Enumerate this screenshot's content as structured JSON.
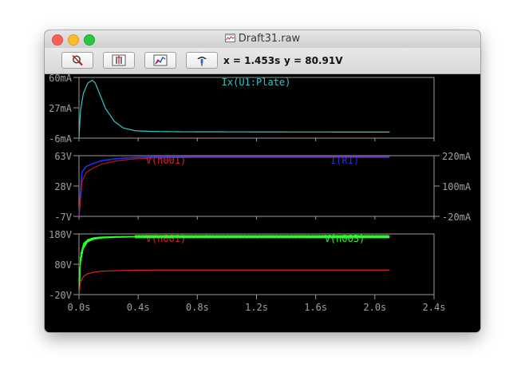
{
  "window": {
    "title": "Draft31.raw"
  },
  "toolbar": {
    "buttons": [
      {
        "icon": "zoom-cancel-icon"
      },
      {
        "icon": "autorange-y-icon"
      },
      {
        "icon": "zoom-extents-icon"
      },
      {
        "icon": "probe-icon"
      }
    ],
    "x_readout": "x = 1.453s",
    "y_readout": "y = 80.91V"
  },
  "colors": {
    "background": "#000000",
    "frame": "#9a9a9a",
    "tick_text": "#a0a0a0",
    "cyan": "#32c8c8",
    "red": "#e42222",
    "blue": "#2c2cf0",
    "purple": "#b02ad8",
    "green": "#28ff28"
  },
  "x_axis": {
    "ticks": [
      "0.0s",
      "0.4s",
      "0.8s",
      "1.2s",
      "1.6s",
      "2.0s",
      "2.4s"
    ],
    "range": [
      0,
      2.4
    ]
  },
  "chart_data": [
    {
      "type": "line",
      "series": [
        {
          "name": "Ix(U1:Plate)",
          "color": "#32c8c8",
          "x": [
            0,
            0.01,
            0.03,
            0.06,
            0.09,
            0.11,
            0.14,
            0.18,
            0.24,
            0.3,
            0.38,
            0.5,
            0.7,
            1.0,
            1.4,
            2.1
          ],
          "y": [
            -6,
            24,
            43,
            54,
            57,
            54,
            42,
            26,
            12,
            5,
            2,
            1.2,
            0.9,
            0.8,
            0.7,
            0.6
          ]
        }
      ],
      "left_axis": {
        "ticks": [
          "60mA",
          "27mA",
          "-6mA"
        ],
        "range": [
          -6,
          60
        ]
      }
    },
    {
      "type": "line",
      "series": [
        {
          "name": "V(n001)",
          "color": "#e42222",
          "x": [
            0,
            0.02,
            0.05,
            0.1,
            0.15,
            0.25,
            0.35,
            0.5,
            0.8,
            1.2,
            1.6,
            2.1
          ],
          "y": [
            -7,
            33,
            44,
            49,
            53,
            57,
            59,
            60.5,
            61,
            61,
            61,
            61
          ]
        },
        {
          "name": "I(R1)",
          "color": "#2c2cf0",
          "x": [
            0,
            0.02,
            0.05,
            0.1,
            0.15,
            0.25,
            0.35,
            0.5,
            0.8,
            1.2,
            1.6,
            2.1
          ],
          "y": [
            -20,
            155,
            178,
            190,
            200,
            208,
            212,
            215,
            216,
            216,
            216,
            216
          ]
        }
      ],
      "left_axis": {
        "ticks": [
          "63V",
          "28V",
          "-7V"
        ],
        "range": [
          -7,
          63
        ]
      },
      "right_axis": {
        "ticks": [
          "220mA",
          "100mA",
          "-20mA"
        ],
        "range": [
          -20,
          220
        ]
      }
    },
    {
      "type": "line",
      "series": [
        {
          "name": "V(n001)",
          "color": "#e42222",
          "x": [
            0,
            0.01,
            0.03,
            0.06,
            0.1,
            0.15,
            0.25,
            0.4,
            0.6,
            1.0,
            1.5,
            2.1
          ],
          "y": [
            -20,
            22,
            40,
            49,
            54,
            57,
            59,
            60.5,
            61,
            61,
            61,
            61
          ]
        },
        {
          "name": "V(n003)",
          "color": "#28ff28",
          "x": [
            0,
            0.01,
            0.03,
            0.06,
            0.1,
            0.15,
            0.25,
            0.4,
            0.6,
            1.0,
            1.5,
            2.1
          ],
          "y": [
            -20,
            95,
            140,
            158,
            165,
            168,
            170,
            171,
            171,
            171,
            171,
            171
          ],
          "ripple": [
            110,
            40,
            20,
            10,
            8,
            6,
            5,
            4,
            4,
            4,
            4,
            4
          ]
        }
      ],
      "left_axis": {
        "ticks": [
          "180V",
          "80V",
          "-20V"
        ],
        "range": [
          -20,
          180
        ]
      }
    }
  ]
}
